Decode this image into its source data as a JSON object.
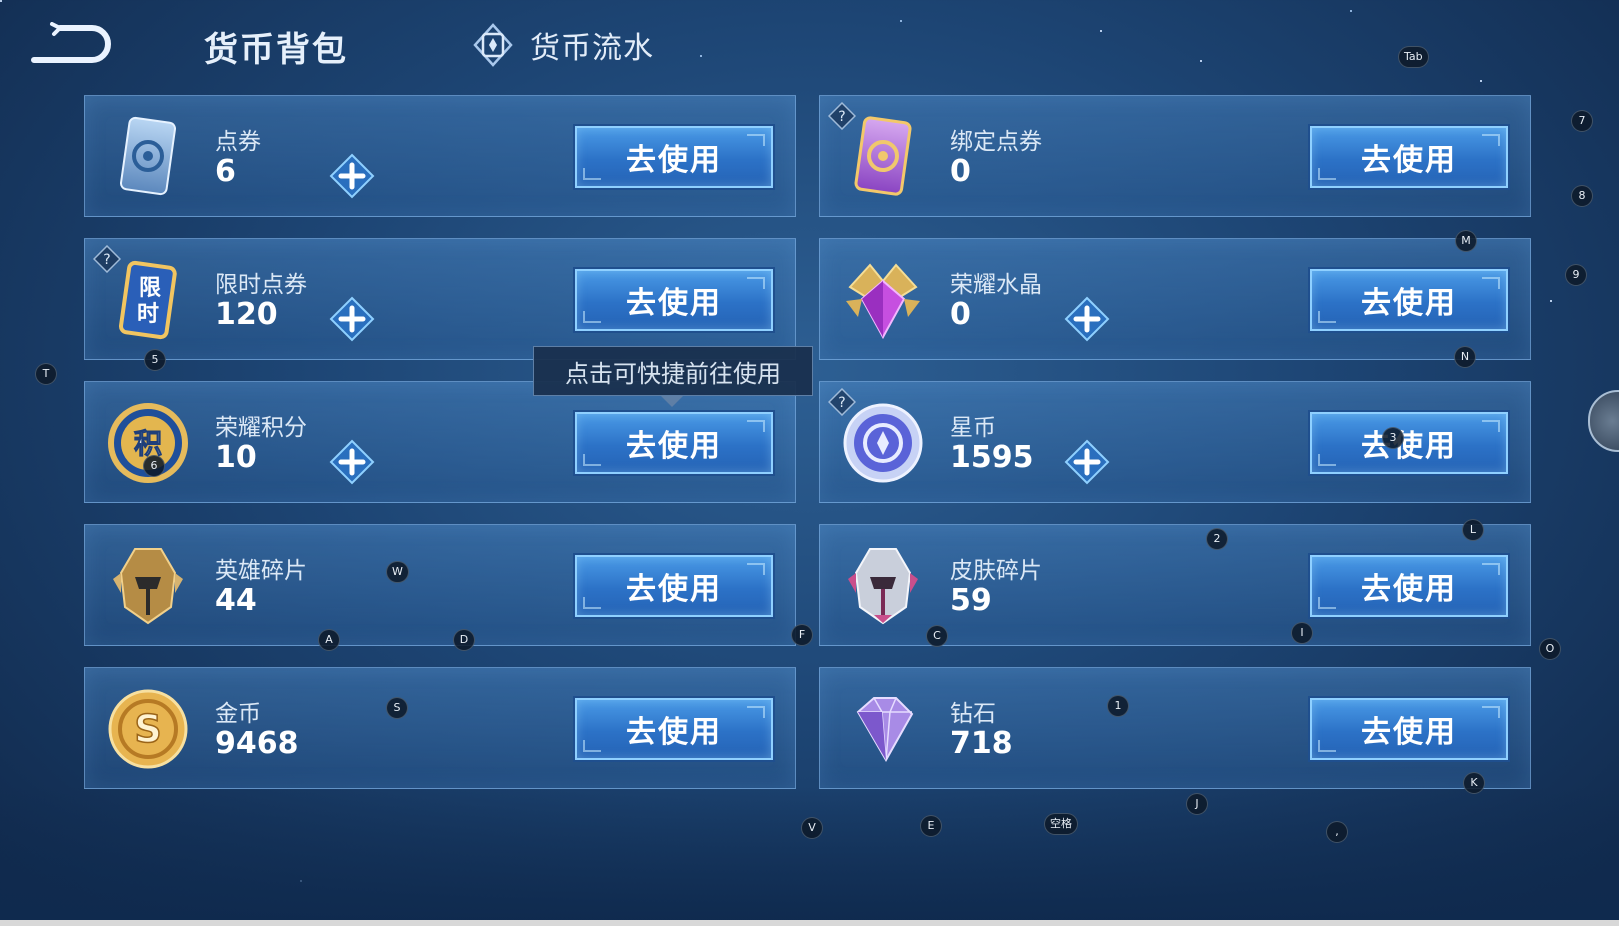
{
  "header": {
    "title": "货币背包",
    "ledger_label": "货币流水"
  },
  "currencies": [
    {
      "name": "点券",
      "value": "6",
      "button": "去使用"
    },
    {
      "name": "绑定点券",
      "value": "0",
      "button": "去使用"
    },
    {
      "name": "限时点券",
      "value": "120",
      "button": "去使用"
    },
    {
      "name": "荣耀水晶",
      "value": "0",
      "button": "去使用"
    },
    {
      "name": "荣耀积分",
      "value": "10",
      "button": "去使用"
    },
    {
      "name": "星币",
      "value": "1595",
      "button": "去使用"
    },
    {
      "name": "英雄碎片",
      "value": "44",
      "button": "去使用"
    },
    {
      "name": "皮肤碎片",
      "value": "59",
      "button": "去使用"
    },
    {
      "name": "金币",
      "value": "9468",
      "button": "去使用"
    },
    {
      "name": "钻石",
      "value": "718",
      "button": "去使用"
    }
  ],
  "tooltip": "点击可快捷前往使用",
  "icon_glyphs": {
    "limited_coupon": [
      "限",
      "时"
    ],
    "points": "积",
    "gold": "S"
  },
  "key_hints": [
    "Tab",
    "7",
    "8",
    "M",
    "9",
    "T",
    "5",
    "N",
    "6",
    "3",
    "2",
    "L",
    "W",
    "A",
    "D",
    "F",
    "C",
    "I",
    "O",
    "S",
    "1",
    "K",
    "J",
    "V",
    "E",
    "空格",
    ","
  ],
  "colors": {
    "background": "#1d4574",
    "card": "#3a78b8",
    "button": "#2c72c7",
    "button_border": "#8fd0ff"
  }
}
